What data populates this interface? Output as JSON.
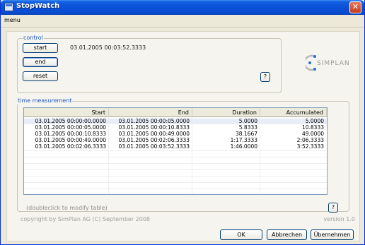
{
  "window": {
    "title": "StopWatch",
    "close_glyph": "✕"
  },
  "menubar": {
    "items": [
      {
        "label": "menu"
      }
    ]
  },
  "control": {
    "legend": "control",
    "start_label": "start",
    "end_label": "end",
    "reset_label": "reset",
    "help_label": "?",
    "current_time": "03.01.2005 00:03:52.3333"
  },
  "logo": {
    "text": "SIMPLAN"
  },
  "measurement": {
    "legend": "time measurement",
    "columns": [
      "Start",
      "End",
      "Duration",
      "Accumulated"
    ],
    "rows": [
      {
        "start": "03.01.2005 00:00:00.0000",
        "end": "03.01.2005 00:00:05.0000",
        "duration": "5.0000",
        "accumulated": "5.0000"
      },
      {
        "start": "03.01.2005 00:00:05.0000",
        "end": "03.01.2005 00:00:10.8333",
        "duration": "5.8333",
        "accumulated": "10.8333"
      },
      {
        "start": "03.01.2005 00:00:10.8333",
        "end": "03.01.2005 00:00:49.0000",
        "duration": "38.1667",
        "accumulated": "49.0000"
      },
      {
        "start": "03.01.2005 00:00:49.0000",
        "end": "03.01.2005 00:02:06.3333",
        "duration": "1:17.3333",
        "accumulated": "2:06.3333"
      },
      {
        "start": "03.01.2005 00:02:06.3333",
        "end": "03.01.2005 00:03:52.3333",
        "duration": "1:46.0000",
        "accumulated": "3:52.3333"
      }
    ],
    "hint": "(doubleclick to modify table)",
    "help_label": "?"
  },
  "footer": {
    "copyright": "copyright by SimPlan AG (C) September 2008",
    "version": "version 1.0"
  },
  "dialog_buttons": {
    "ok": "OK",
    "cancel": "Abbrechen",
    "apply": "Übernehmen"
  },
  "colors": {
    "titlebar": "#0a50d8",
    "legend": "#1e56c7",
    "close": "#c33b1c"
  }
}
